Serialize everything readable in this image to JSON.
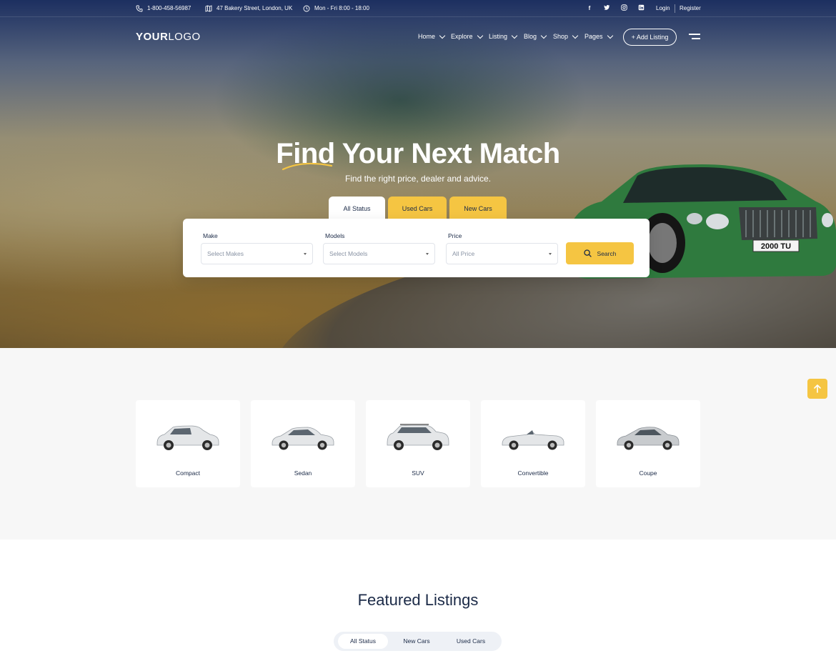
{
  "topbar": {
    "phone": "1-800-458-56987",
    "address": "47 Bakery Street, London, UK",
    "hours": "Mon - Fri 8:00 - 18:00",
    "social": [
      "facebook-icon",
      "twitter-icon",
      "instagram-icon",
      "linkedin-icon"
    ],
    "login": "Login",
    "register": "Register"
  },
  "header": {
    "logo_bold": "YOUR",
    "logo_light": "LOGO",
    "nav": [
      {
        "label": "Home"
      },
      {
        "label": "Explore"
      },
      {
        "label": "Listing"
      },
      {
        "label": "Blog"
      },
      {
        "label": "Shop"
      },
      {
        "label": "Pages"
      }
    ],
    "add_listing": "+ Add Listing"
  },
  "hero": {
    "title": "Find Your Next Match",
    "subtitle": "Find the right price, dealer and advice.",
    "plate": "2000 TU",
    "tabs": [
      "All Status",
      "Used Cars",
      "New Cars"
    ],
    "fields": [
      {
        "label": "Make",
        "placeholder": "Select Makes"
      },
      {
        "label": "Models",
        "placeholder": "Select Models"
      },
      {
        "label": "Price",
        "placeholder": "All Price"
      }
    ],
    "search": "Search",
    "accent": "#f5c542"
  },
  "categories": [
    {
      "label": "Compact"
    },
    {
      "label": "Sedan"
    },
    {
      "label": "SUV"
    },
    {
      "label": "Convertible"
    },
    {
      "label": "Coupe"
    }
  ],
  "featured": {
    "title": "Featured Listings",
    "tabs": [
      "All Status",
      "New Cars",
      "Used Cars"
    ],
    "active": "All Status"
  }
}
